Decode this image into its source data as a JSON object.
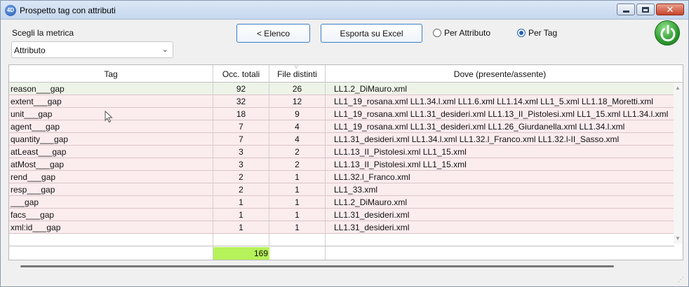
{
  "window": {
    "title": "Prospetto tag con attributi",
    "app_icon": "4D"
  },
  "toolbar": {
    "metric_label": "Scegli la metrica",
    "metric_value": "Attributo",
    "elenco_button": "< Elenco",
    "export_button": "Esporta su Excel",
    "radio_attr": "Per Attributo",
    "radio_tag": "Per Tag",
    "selected_radio": "Per Tag"
  },
  "table": {
    "headers": [
      "Tag",
      "Occ. totali",
      "File distinti",
      "Dove (presente/assente)"
    ],
    "rows": [
      {
        "tag": "reason___gap",
        "occ": "92",
        "files": "26",
        "dove": "LL1.2_DiMauro.xml"
      },
      {
        "tag": "extent___gap",
        "occ": "32",
        "files": "12",
        "dove": "LL1_19_rosana.xml   LL1.34.l.xml   LL1.6.xml   LL1.14.xml   LL1_5.xml   LL1.18_Moretti.xml"
      },
      {
        "tag": "unit___gap",
        "occ": "18",
        "files": "9",
        "dove": "LL1_19_rosana.xml   LL1.31_desideri.xml   LL1.13_II_Pistolesi.xml   LL1_15.xml   LL1.34.l.xml"
      },
      {
        "tag": "agent___gap",
        "occ": "7",
        "files": "4",
        "dove": "LL1_19_rosana.xml   LL1.31_desideri.xml   LL1.26_Giurdanella.xml   LL1.34.l.xml"
      },
      {
        "tag": "quantity___gap",
        "occ": "7",
        "files": "4",
        "dove": "LL1.31_desideri.xml   LL1.34.l.xml   LL1.32.l_Franco.xml   LL1.32.l-II_Sasso.xml"
      },
      {
        "tag": "atLeast___gap",
        "occ": "3",
        "files": "2",
        "dove": "LL1.13_II_Pistolesi.xml   LL1_15.xml"
      },
      {
        "tag": "atMost___gap",
        "occ": "3",
        "files": "2",
        "dove": "LL1.13_II_Pistolesi.xml   LL1_15.xml"
      },
      {
        "tag": "rend___gap",
        "occ": "2",
        "files": "1",
        "dove": "LL1.32.l_Franco.xml"
      },
      {
        "tag": "resp___gap",
        "occ": "2",
        "files": "1",
        "dove": "LL1_33.xml"
      },
      {
        "tag": "___gap",
        "occ": "1",
        "files": "1",
        "dove": "LL1.2_DiMauro.xml"
      },
      {
        "tag": "facs___gap",
        "occ": "1",
        "files": "1",
        "dove": "LL1.31_desideri.xml"
      },
      {
        "tag": "xml:id___gap",
        "occ": "1",
        "files": "1",
        "dove": "LL1.31_desideri.xml"
      }
    ],
    "total": "169"
  },
  "colors": {
    "row_bg": "#fbecee",
    "first_row_bg": "#eef3e8",
    "total_bg": "#b6f25a",
    "accent": "#1f5fb8",
    "power_green": "#2c9a2e"
  }
}
